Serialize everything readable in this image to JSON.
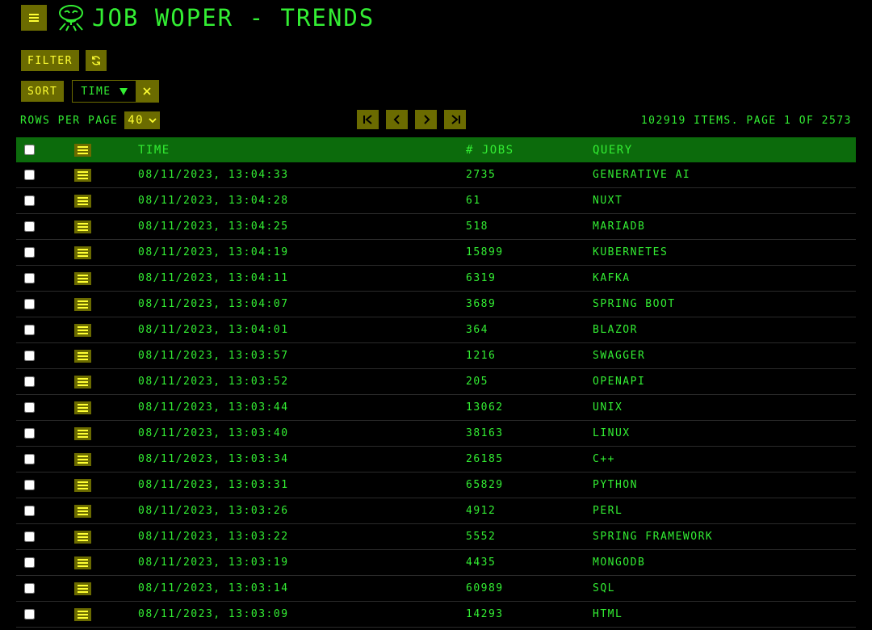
{
  "app": {
    "title": "Job Woper - Trends",
    "logo_icon": "alien-icon",
    "colors": {
      "background": "#000000",
      "text": "#33ee33",
      "button": "#6b6b00",
      "button_text": "#ffff33",
      "header": "#0c6b0c"
    }
  },
  "toolbar": {
    "filter_label": "Filter",
    "refresh_icon": "refresh-icon",
    "sort_label": "Sort",
    "sort_chip": {
      "label": "Time",
      "direction_icon": "triangle-down-icon",
      "remove_icon": "close-icon"
    }
  },
  "pagination": {
    "rows_per_page_label": "Rows per page",
    "rows_per_page_value": "40",
    "info": "102919 items. Page 1 of 2573",
    "buttons": [
      "first-page-icon",
      "prev-page-icon",
      "next-page-icon",
      "last-page-icon"
    ]
  },
  "table": {
    "columns": {
      "time": "Time",
      "jobs": "# Jobs",
      "query": "Query"
    },
    "rows": [
      {
        "time": "08/11/2023, 13:04:33",
        "jobs": "2735",
        "query": "generative ai"
      },
      {
        "time": "08/11/2023, 13:04:28",
        "jobs": "61",
        "query": "nuxt"
      },
      {
        "time": "08/11/2023, 13:04:25",
        "jobs": "518",
        "query": "mariadb"
      },
      {
        "time": "08/11/2023, 13:04:19",
        "jobs": "15899",
        "query": "kubernetes"
      },
      {
        "time": "08/11/2023, 13:04:11",
        "jobs": "6319",
        "query": "kafka"
      },
      {
        "time": "08/11/2023, 13:04:07",
        "jobs": "3689",
        "query": "spring boot"
      },
      {
        "time": "08/11/2023, 13:04:01",
        "jobs": "364",
        "query": "blazor"
      },
      {
        "time": "08/11/2023, 13:03:57",
        "jobs": "1216",
        "query": "swagger"
      },
      {
        "time": "08/11/2023, 13:03:52",
        "jobs": "205",
        "query": "openapi"
      },
      {
        "time": "08/11/2023, 13:03:44",
        "jobs": "13062",
        "query": "unix"
      },
      {
        "time": "08/11/2023, 13:03:40",
        "jobs": "38163",
        "query": "linux"
      },
      {
        "time": "08/11/2023, 13:03:34",
        "jobs": "26185",
        "query": "c++"
      },
      {
        "time": "08/11/2023, 13:03:31",
        "jobs": "65829",
        "query": "python"
      },
      {
        "time": "08/11/2023, 13:03:26",
        "jobs": "4912",
        "query": "perl"
      },
      {
        "time": "08/11/2023, 13:03:22",
        "jobs": "5552",
        "query": "spring framework"
      },
      {
        "time": "08/11/2023, 13:03:19",
        "jobs": "4435",
        "query": "mongodb"
      },
      {
        "time": "08/11/2023, 13:03:14",
        "jobs": "60989",
        "query": "sql"
      },
      {
        "time": "08/11/2023, 13:03:09",
        "jobs": "14293",
        "query": "html"
      }
    ]
  }
}
